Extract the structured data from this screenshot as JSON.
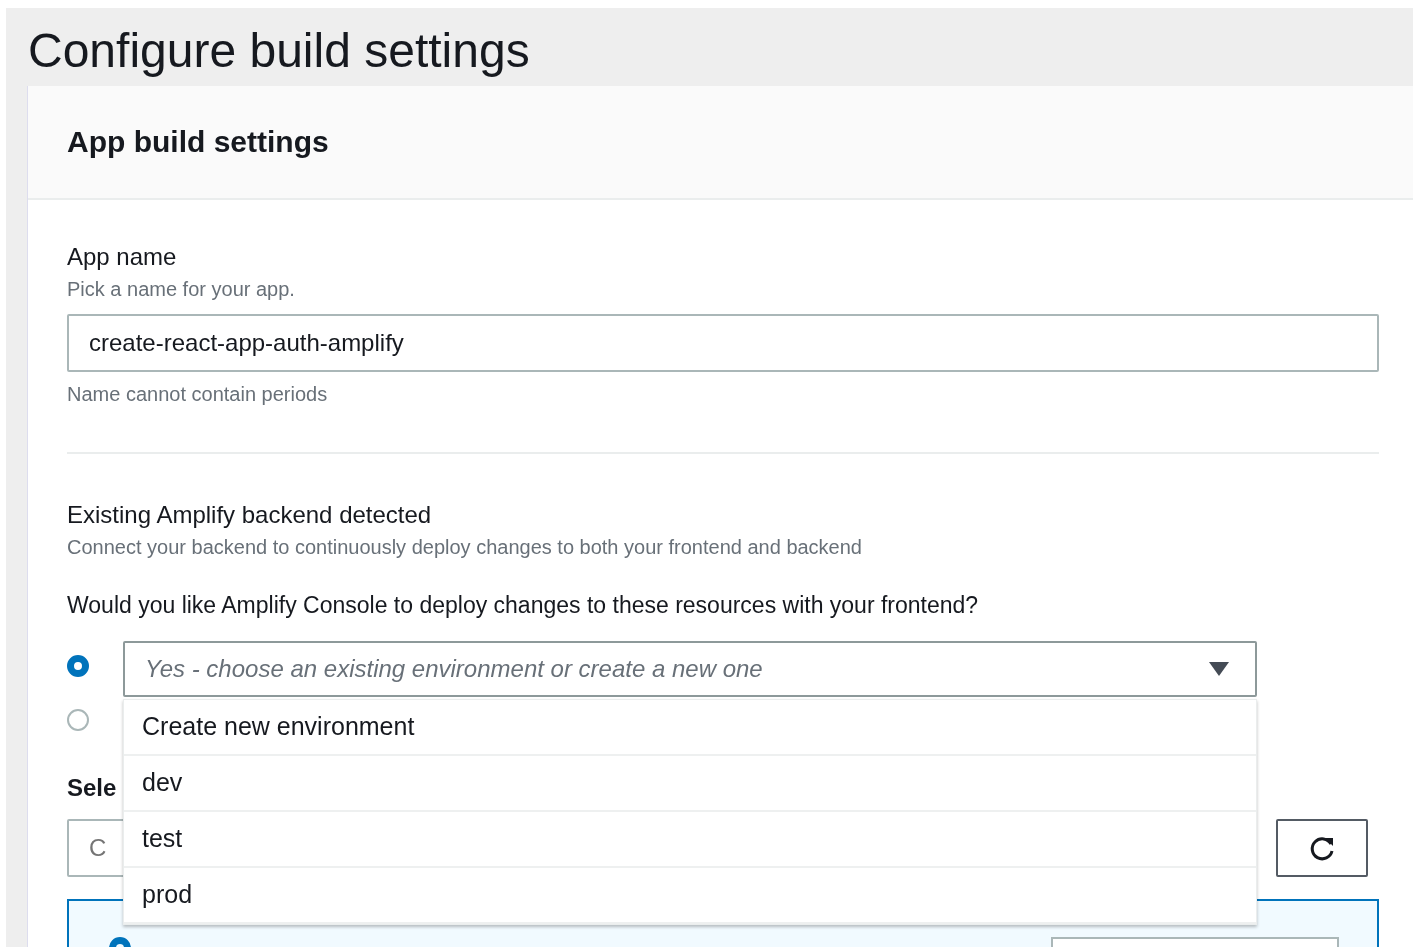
{
  "page_title": "Configure build settings",
  "card": {
    "title": "App build settings",
    "app_name": {
      "label": "App name",
      "hint": "Pick a name for your app.",
      "value": "create-react-app-auth-amplify",
      "note": "Name cannot contain periods"
    },
    "backend": {
      "title": "Existing Amplify backend detected",
      "description": "Connect your backend to continuously deploy changes to both your frontend and backend",
      "question": "Would you like Amplify Console to deploy changes to these resources with your frontend?"
    },
    "radios": [
      {
        "selected": true
      },
      {
        "selected": false
      }
    ],
    "environment_select": {
      "placeholder": "Yes - choose an existing environment or create a new one",
      "expanded": true,
      "options": [
        {
          "label": "Create new environment"
        },
        {
          "label": "dev"
        },
        {
          "label": "test"
        },
        {
          "label": "prod"
        }
      ]
    },
    "role_label": "Sele",
    "role_field": {
      "placeholder": "C"
    }
  }
}
